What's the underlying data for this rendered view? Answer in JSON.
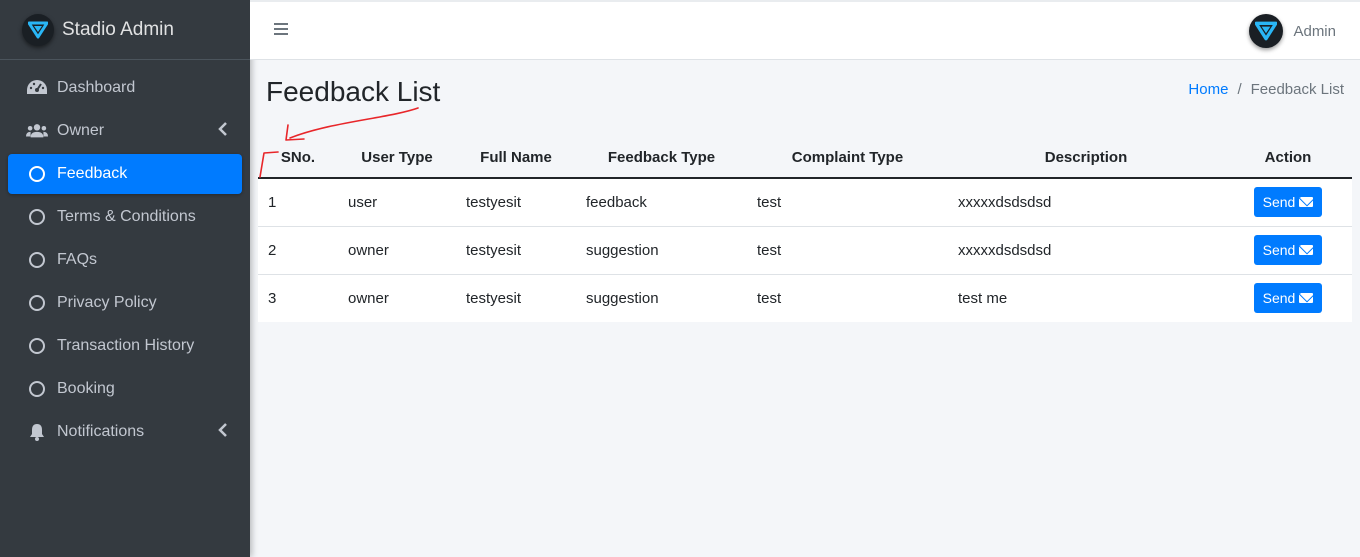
{
  "brand": {
    "name": "Stadio Admin",
    "logo_icon": "stadio-logo-icon"
  },
  "sidebar": {
    "items": [
      {
        "label": "Dashboard",
        "icon": "tachometer-icon",
        "active": false,
        "chevron": false
      },
      {
        "label": "Owner",
        "icon": "users-icon",
        "active": false,
        "chevron": true
      },
      {
        "label": "Feedback",
        "icon": "circle-icon",
        "active": true,
        "chevron": false
      },
      {
        "label": "Terms & Conditions",
        "icon": "circle-icon",
        "active": false,
        "chevron": false
      },
      {
        "label": "FAQs",
        "icon": "circle-icon",
        "active": false,
        "chevron": false
      },
      {
        "label": "Privacy Policy",
        "icon": "circle-icon",
        "active": false,
        "chevron": false
      },
      {
        "label": "Transaction History",
        "icon": "circle-icon",
        "active": false,
        "chevron": false
      },
      {
        "label": "Booking",
        "icon": "circle-icon",
        "active": false,
        "chevron": false
      },
      {
        "label": "Notifications",
        "icon": "bell-icon",
        "active": false,
        "chevron": true
      }
    ]
  },
  "topbar": {
    "user_name": "Admin"
  },
  "page": {
    "title": "Feedback List",
    "breadcrumb": {
      "home": "Home",
      "current": "Feedback List"
    }
  },
  "table": {
    "headers": [
      "SNo.",
      "User Type",
      "Full Name",
      "Feedback Type",
      "Complaint Type",
      "Description",
      "Action"
    ],
    "rows": [
      [
        "1",
        "user",
        "testyesit",
        "feedback",
        "test",
        "xxxxxdsdsdsd"
      ],
      [
        "2",
        "owner",
        "testyesit",
        "suggestion",
        "test",
        "xxxxxdsdsdsd"
      ],
      [
        "3",
        "owner",
        "testyesit",
        "suggestion",
        "test",
        "test me"
      ]
    ],
    "action_label": "Send"
  },
  "colors": {
    "sidebar_bg": "#343a40",
    "active": "#007bff",
    "annotation": "#e8262a"
  }
}
